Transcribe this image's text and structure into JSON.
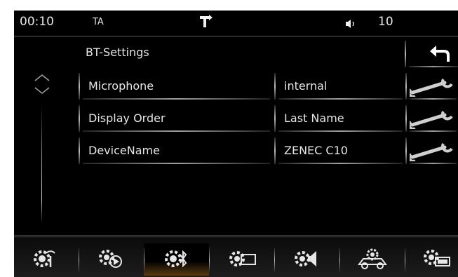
{
  "status_bar": {
    "time": "00:10",
    "ta_label": "TA",
    "volume_level": "10",
    "nav_icon": "turn-right-arrow-icon",
    "volume_icon": "speaker-icon"
  },
  "header": {
    "title": "BT-Settings",
    "back_icon": "back-arrow-icon"
  },
  "scroller": {
    "icon": "up-down-chevron-icon"
  },
  "settings": [
    {
      "label": "Microphone",
      "value": "internal"
    },
    {
      "label": "Display Order",
      "value": "Last Name"
    },
    {
      "label": "DeviceName",
      "value": "ZENEC C10"
    }
  ],
  "bottom_tabs": [
    {
      "icon": "gear-antenna-icon",
      "active": false
    },
    {
      "icon": "gear-play-icon",
      "active": false
    },
    {
      "icon": "gear-bluetooth-icon",
      "active": true
    },
    {
      "icon": "gear-screen-icon",
      "active": false
    },
    {
      "icon": "gear-speaker-icon",
      "active": false
    },
    {
      "icon": "gear-car-icon",
      "active": false
    },
    {
      "icon": "gear-display-icon",
      "active": false
    }
  ],
  "colors": {
    "background": "#000000",
    "text": "#e6e6e6",
    "active_tab": "#5a3b10"
  }
}
